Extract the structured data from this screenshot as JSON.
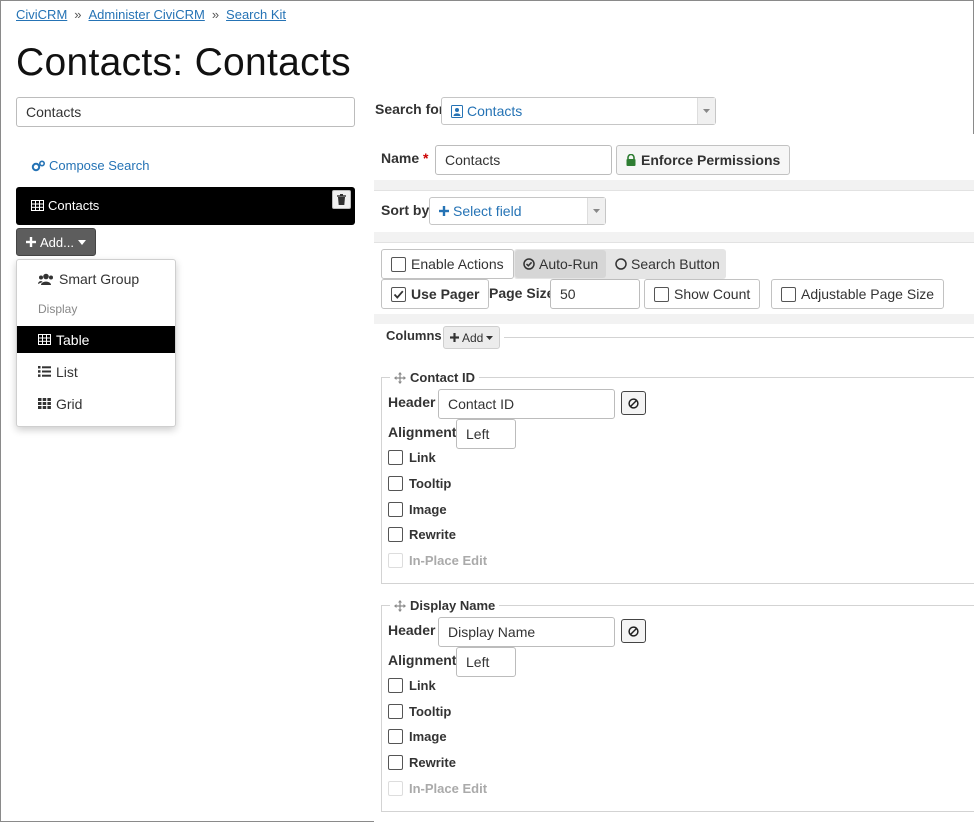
{
  "breadcrumb": {
    "items": [
      "CiviCRM",
      "Administer CiviCRM",
      "Search Kit"
    ],
    "separator": "»"
  },
  "page_title": "Contacts: Contacts",
  "left": {
    "search_label_value": "Contacts",
    "compose_label": "Compose Search",
    "display_bar_label": "Contacts",
    "add_button_label": "Add...",
    "menu": {
      "smart_group": "Smart Group",
      "section_header": "Display",
      "table": "Table",
      "list": "List",
      "grid": "Grid"
    }
  },
  "right": {
    "search_for_label": "Search for",
    "search_for_value": "Contacts",
    "name_label": "Name",
    "name_required_marker": "*",
    "name_value": "Contacts",
    "enforce_permissions_label": "Enforce Permissions",
    "sort_by_label": "Sort by",
    "sort_by_placeholder": "Select field",
    "options": {
      "enable_actions": "Enable Actions",
      "auto_run": "Auto-Run",
      "search_button": "Search Button",
      "use_pager": "Use Pager",
      "page_size_label": "Page Size",
      "page_size_value": "50",
      "show_count": "Show Count",
      "adjustable_page_size": "Adjustable Page Size"
    },
    "columns_label": "Columns",
    "columns_add_label": "Add",
    "columns": [
      {
        "title": "Contact ID",
        "header_label": "Header",
        "header_value": "Contact ID",
        "alignment_label": "Alignment",
        "alignment_value": "Left",
        "link": "Link",
        "tooltip": "Tooltip",
        "image": "Image",
        "rewrite": "Rewrite",
        "in_place_edit": "In-Place Edit"
      },
      {
        "title": "Display Name",
        "header_label": "Header",
        "header_value": "Display Name",
        "alignment_label": "Alignment",
        "alignment_value": "Left",
        "link": "Link",
        "tooltip": "Tooltip",
        "image": "Image",
        "rewrite": "Rewrite",
        "in_place_edit": "In-Place Edit"
      }
    ]
  },
  "colors": {
    "link": "#2573b5",
    "active_bg": "#000000",
    "required": "#cc0000",
    "lock": "#2e7d32"
  },
  "icons": [
    "cogs-icon",
    "table-icon",
    "trash-icon",
    "plus-icon",
    "caret-down-icon",
    "users-icon",
    "list-icon",
    "grid-icon",
    "address-card-icon",
    "lock-icon",
    "check-circle-icon",
    "circle-icon",
    "check-icon",
    "move-icon",
    "ban-icon"
  ]
}
